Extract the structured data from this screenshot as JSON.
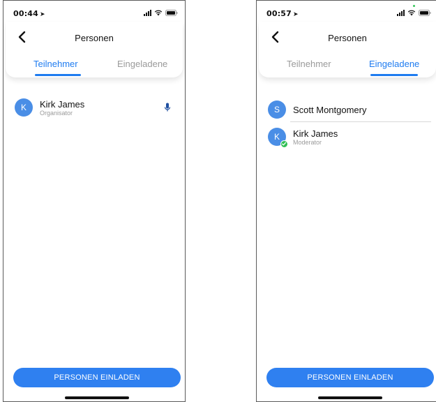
{
  "screens": [
    {
      "status": {
        "time": "00:44",
        "location_glyph": "➤"
      },
      "header": {
        "title": "Personen",
        "tabs": [
          {
            "label": "Teilnehmer",
            "active": true
          },
          {
            "label": "Eingeladene",
            "active": false
          }
        ]
      },
      "people": [
        {
          "initial": "K",
          "name": "Kirk James",
          "role": "Organisator",
          "mic": true
        }
      ],
      "invite_button": "PERSONEN EINLADEN"
    },
    {
      "status": {
        "time": "00:57",
        "location_glyph": "➤"
      },
      "header": {
        "title": "Personen",
        "tabs": [
          {
            "label": "Teilnehmer",
            "active": false
          },
          {
            "label": "Eingeladene",
            "active": true
          }
        ]
      },
      "people": [
        {
          "initial": "S",
          "name": "Scott Montgomery"
        },
        {
          "initial": "K",
          "name": "Kirk James",
          "role": "Moderator",
          "verified": true
        }
      ],
      "invite_button": "PERSONEN EINLADEN"
    }
  ],
  "colors": {
    "accent": "#1f7cf0",
    "avatar": "#4a8ee6",
    "verified": "#2fbf54",
    "button": "#2f80f0"
  },
  "icons": [
    "back-chevron-icon",
    "microphone-icon",
    "check-badge-icon",
    "signal-icon",
    "wifi-icon",
    "battery-icon",
    "location-arrow-icon"
  ]
}
